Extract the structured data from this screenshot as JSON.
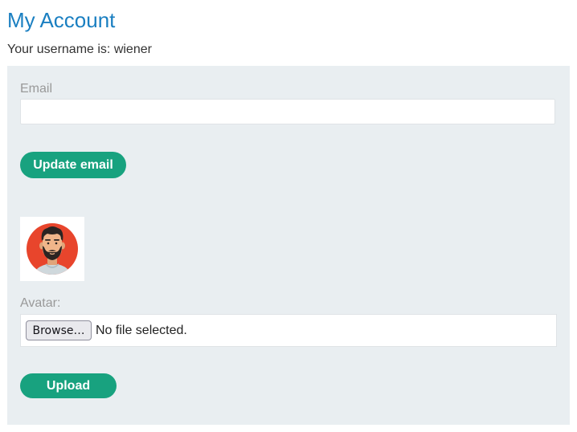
{
  "header": {
    "title": "My Account",
    "username_text": "Your username is: wiener"
  },
  "email_form": {
    "label": "Email",
    "value": "",
    "placeholder": "",
    "submit_label": "Update email"
  },
  "avatar_form": {
    "label": "Avatar:",
    "browse_label": "Browse…",
    "file_status": "No file selected.",
    "submit_label": "Upload"
  },
  "colors": {
    "title": "#1a7fc1",
    "panel_background": "#e9eef1",
    "button": "#18a27f",
    "avatar_circle": "#e8452c"
  },
  "icons": {
    "avatar_image": "bearded-man-avatar"
  }
}
